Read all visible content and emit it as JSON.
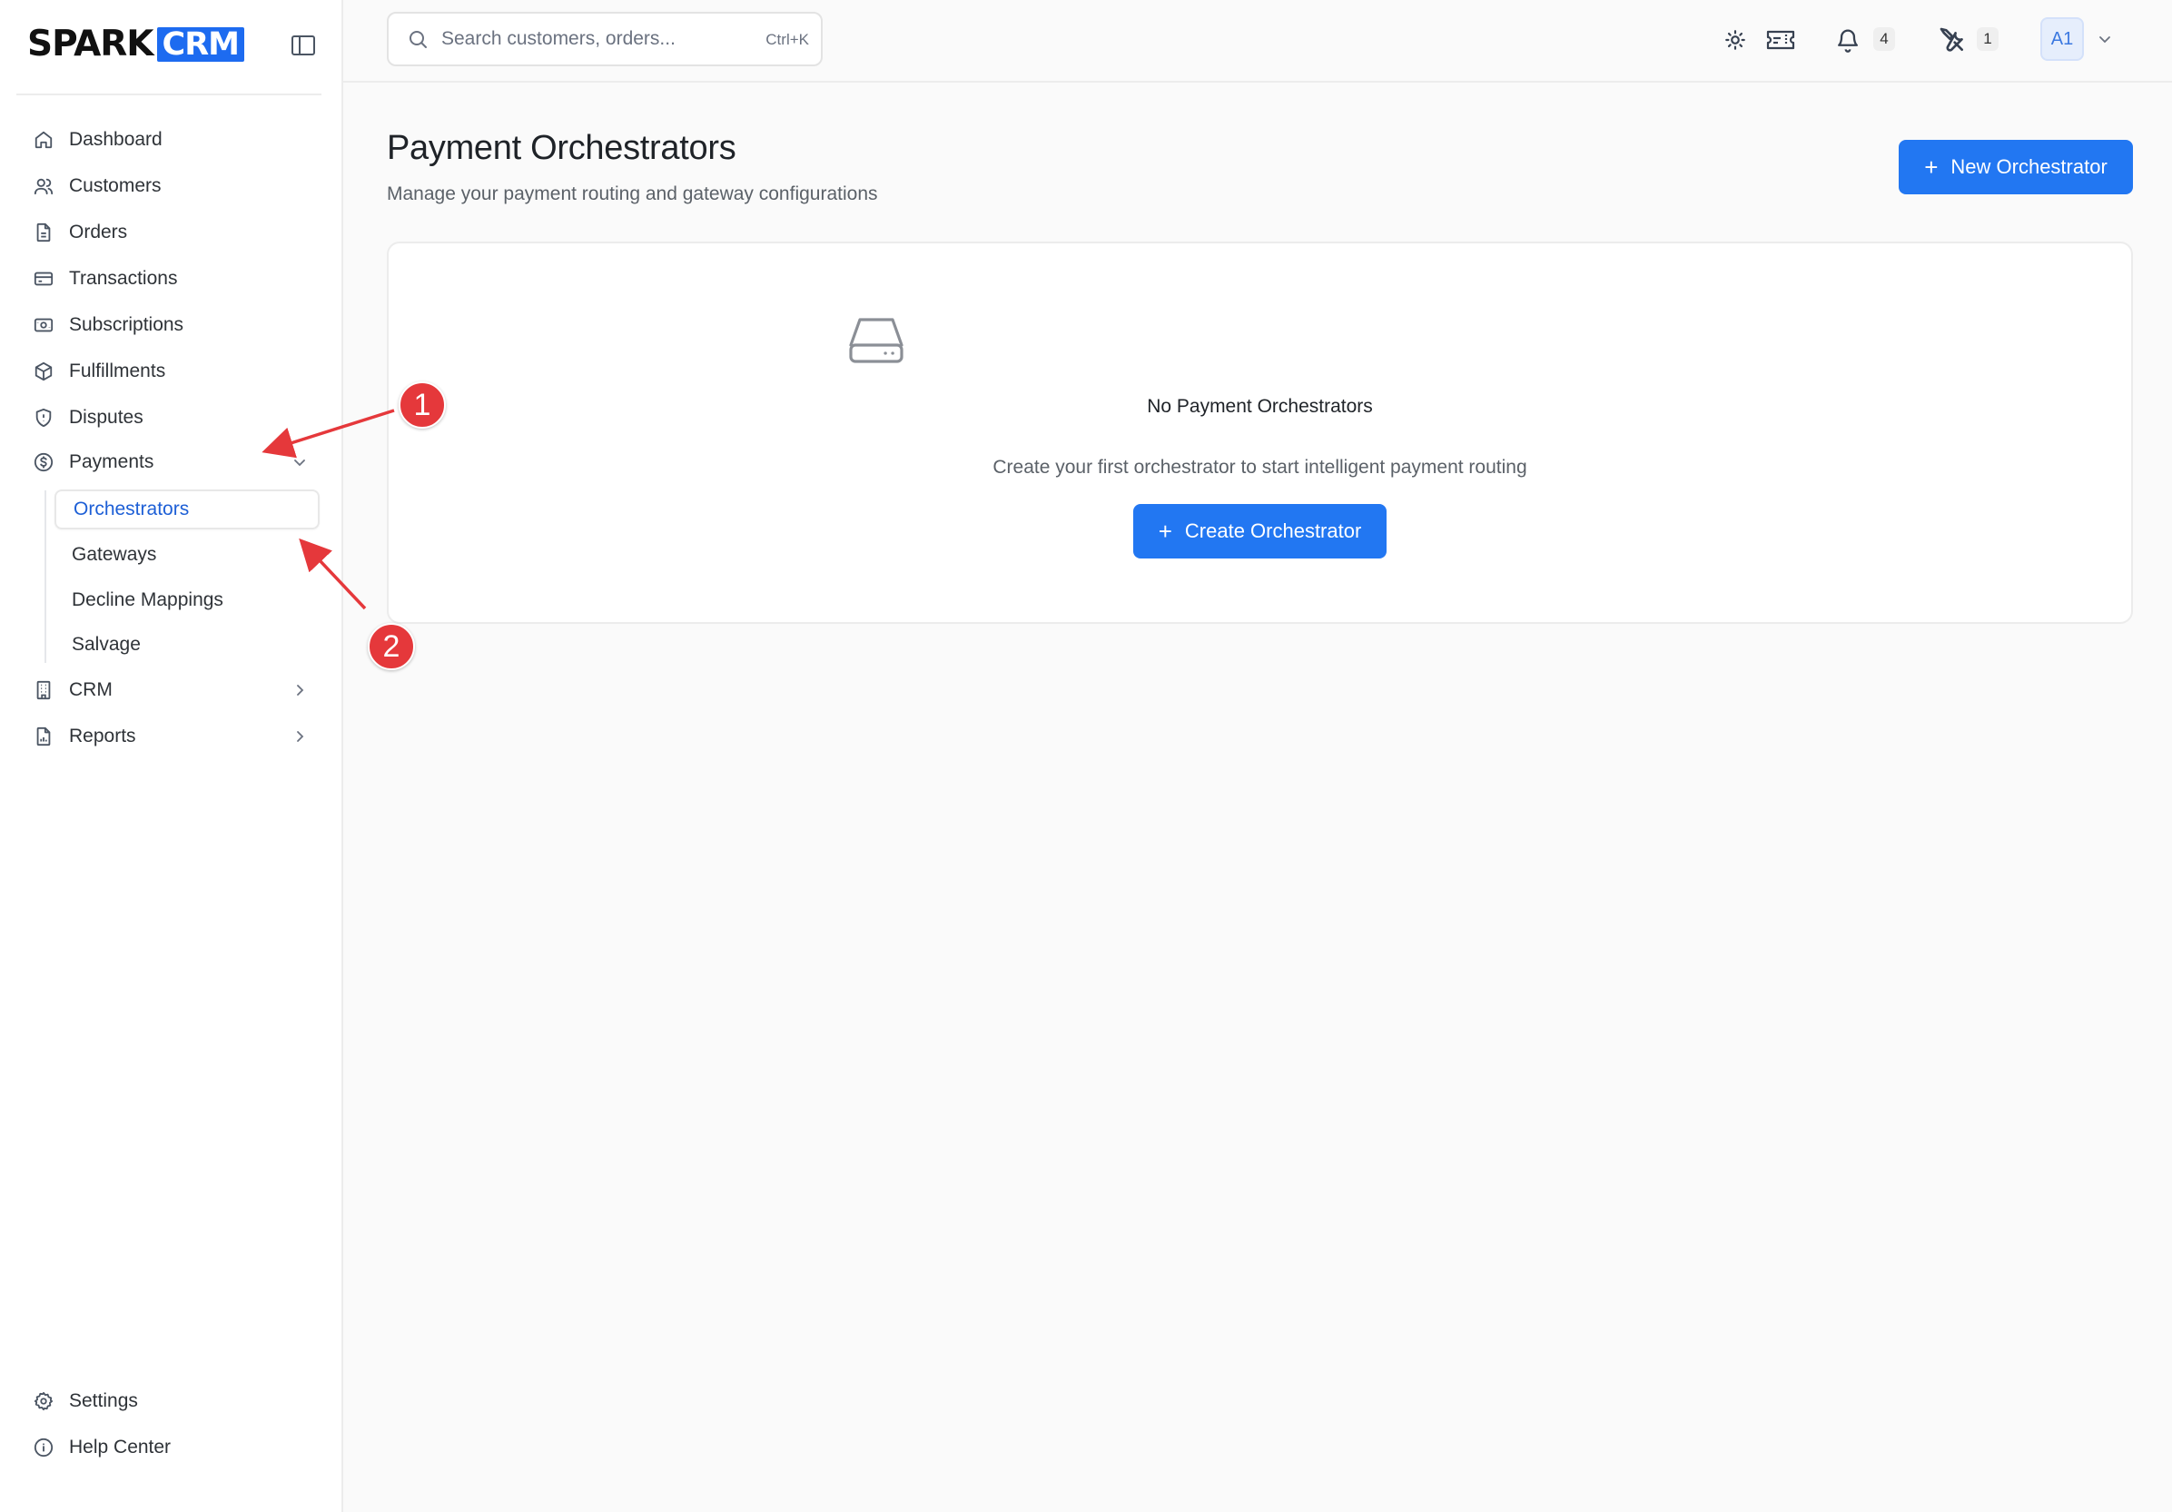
{
  "brand": {
    "part1": "SPARK",
    "part2": "CRM",
    "accent": "#1d6bf0"
  },
  "sidebar": {
    "collapse_icon": "sidebar-toggle-icon",
    "items": [
      {
        "label": "Dashboard",
        "icon": "home-icon"
      },
      {
        "label": "Customers",
        "icon": "users-icon"
      },
      {
        "label": "Orders",
        "icon": "file-icon"
      },
      {
        "label": "Transactions",
        "icon": "credit-card-icon"
      },
      {
        "label": "Subscriptions",
        "icon": "banknote-icon"
      },
      {
        "label": "Fulfillments",
        "icon": "package-icon"
      },
      {
        "label": "Disputes",
        "icon": "shield-icon"
      },
      {
        "label": "Payments",
        "icon": "dollar-circle-icon",
        "expanded": true
      }
    ],
    "payments_sub": [
      {
        "label": "Orchestrators",
        "active": true
      },
      {
        "label": "Gateways"
      },
      {
        "label": "Decline Mappings"
      },
      {
        "label": "Salvage"
      }
    ],
    "more_items": [
      {
        "label": "CRM",
        "icon": "building-icon"
      },
      {
        "label": "Reports",
        "icon": "report-icon"
      }
    ],
    "bottom": [
      {
        "label": "Settings",
        "icon": "gear-icon"
      },
      {
        "label": "Help Center",
        "icon": "info-icon"
      }
    ]
  },
  "topbar": {
    "search_placeholder": "Search customers, orders...",
    "search_shortcut": "Ctrl+K",
    "notifications_count": "4",
    "tools_count": "1",
    "avatar_initials": "A1"
  },
  "main": {
    "title": "Payment Orchestrators",
    "subtitle": "Manage your payment routing and gateway configurations",
    "new_button": "New Orchestrator",
    "empty_title": "No Payment Orchestrators",
    "empty_desc": "Create your first orchestrator to start intelligent payment routing",
    "create_button": "Create Orchestrator",
    "primary_color": "#2277f2"
  },
  "annotations": {
    "callout_1": "1",
    "callout_2": "2",
    "color": "#e5383b"
  }
}
